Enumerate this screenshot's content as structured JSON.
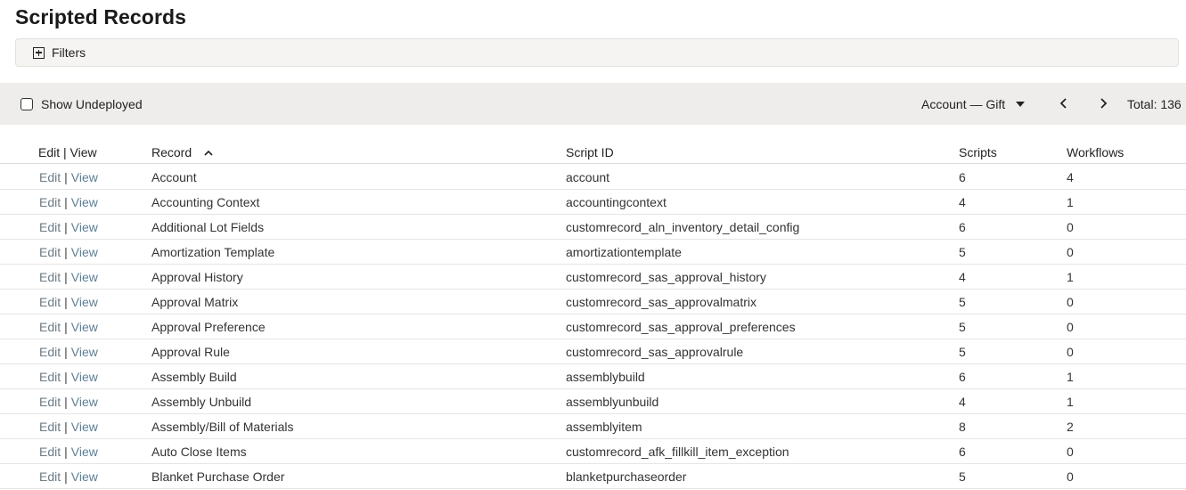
{
  "page": {
    "title": "Scripted Records"
  },
  "filters": {
    "label": "Filters",
    "icon": "plus-square-icon"
  },
  "toolbar": {
    "show_undeployed_label": "Show Undeployed",
    "show_undeployed_checked": false,
    "range_select": "Account — Gift",
    "total": "Total: 136"
  },
  "table": {
    "headers": {
      "edit_view": "Edit | View",
      "record": "Record",
      "script_id": "Script ID",
      "scripts": "Scripts",
      "workflows": "Workflows"
    },
    "sort": {
      "column": "record",
      "direction": "ascending"
    },
    "link_edit": "Edit",
    "link_sep": "|",
    "link_view": "View",
    "rows": [
      {
        "record": "Account",
        "script_id": "account",
        "scripts": "6",
        "workflows": "4"
      },
      {
        "record": "Accounting Context",
        "script_id": "accountingcontext",
        "scripts": "4",
        "workflows": "1"
      },
      {
        "record": "Additional Lot Fields",
        "script_id": "customrecord_aln_inventory_detail_config",
        "scripts": "6",
        "workflows": "0"
      },
      {
        "record": "Amortization Template",
        "script_id": "amortizationtemplate",
        "scripts": "5",
        "workflows": "0"
      },
      {
        "record": "Approval History",
        "script_id": "customrecord_sas_approval_history",
        "scripts": "4",
        "workflows": "1"
      },
      {
        "record": "Approval Matrix",
        "script_id": "customrecord_sas_approvalmatrix",
        "scripts": "5",
        "workflows": "0"
      },
      {
        "record": "Approval Preference",
        "script_id": "customrecord_sas_approval_preferences",
        "scripts": "5",
        "workflows": "0"
      },
      {
        "record": "Approval Rule",
        "script_id": "customrecord_sas_approvalrule",
        "scripts": "5",
        "workflows": "0"
      },
      {
        "record": "Assembly Build",
        "script_id": "assemblybuild",
        "scripts": "6",
        "workflows": "1"
      },
      {
        "record": "Assembly Unbuild",
        "script_id": "assemblyunbuild",
        "scripts": "4",
        "workflows": "1"
      },
      {
        "record": "Assembly/Bill of Materials",
        "script_id": "assemblyitem",
        "scripts": "8",
        "workflows": "2"
      },
      {
        "record": "Auto Close Items",
        "script_id": "customrecord_afk_fillkill_item_exception",
        "scripts": "6",
        "workflows": "0"
      },
      {
        "record": "Blanket Purchase Order",
        "script_id": "blanketpurchaseorder",
        "scripts": "5",
        "workflows": "0"
      }
    ]
  }
}
